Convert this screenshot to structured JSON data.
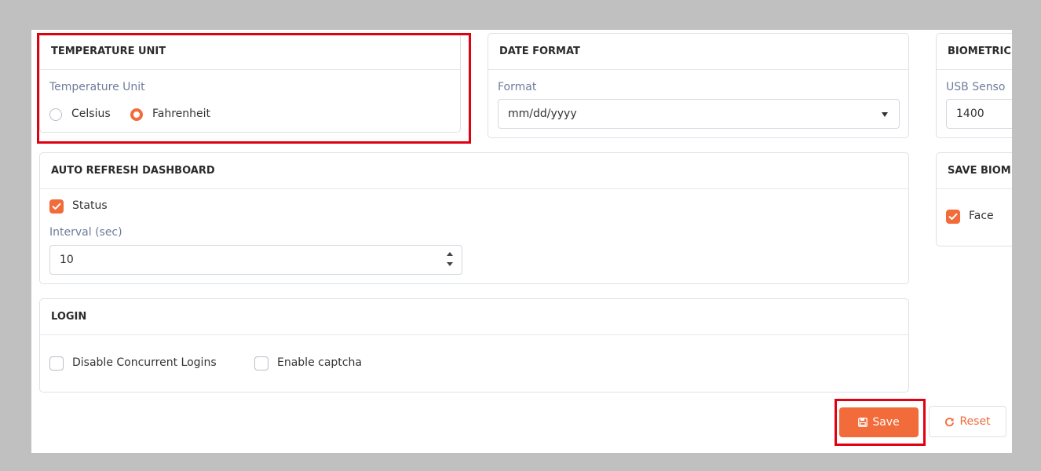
{
  "temperature": {
    "header": "TEMPERATURE UNIT",
    "label": "Temperature Unit",
    "options": [
      {
        "label": "Celsius",
        "selected": false
      },
      {
        "label": "Fahrenheit",
        "selected": true
      }
    ]
  },
  "date_format": {
    "header": "DATE FORMAT",
    "label": "Format",
    "value": "mm/dd/yyyy"
  },
  "biometric": {
    "header": "BIOMETRIC",
    "label": "USB Senso",
    "value": "1400"
  },
  "auto_refresh": {
    "header": "AUTO REFRESH DASHBOARD",
    "status_label": "Status",
    "status_checked": true,
    "interval_label": "Interval (sec)",
    "interval_value": "10"
  },
  "save_biometric": {
    "header": "SAVE BIOM",
    "face_label": "Face",
    "face_checked": true
  },
  "login": {
    "header": "LOGIN",
    "disable_concurrent_label": "Disable Concurrent Logins",
    "disable_concurrent_checked": false,
    "enable_captcha_label": "Enable captcha",
    "enable_captcha_checked": false
  },
  "actions": {
    "save_label": "Save",
    "reset_label": "Reset"
  },
  "colors": {
    "accent": "#f26b3a",
    "highlight": "#e00010",
    "label": "#6e7c9b"
  }
}
